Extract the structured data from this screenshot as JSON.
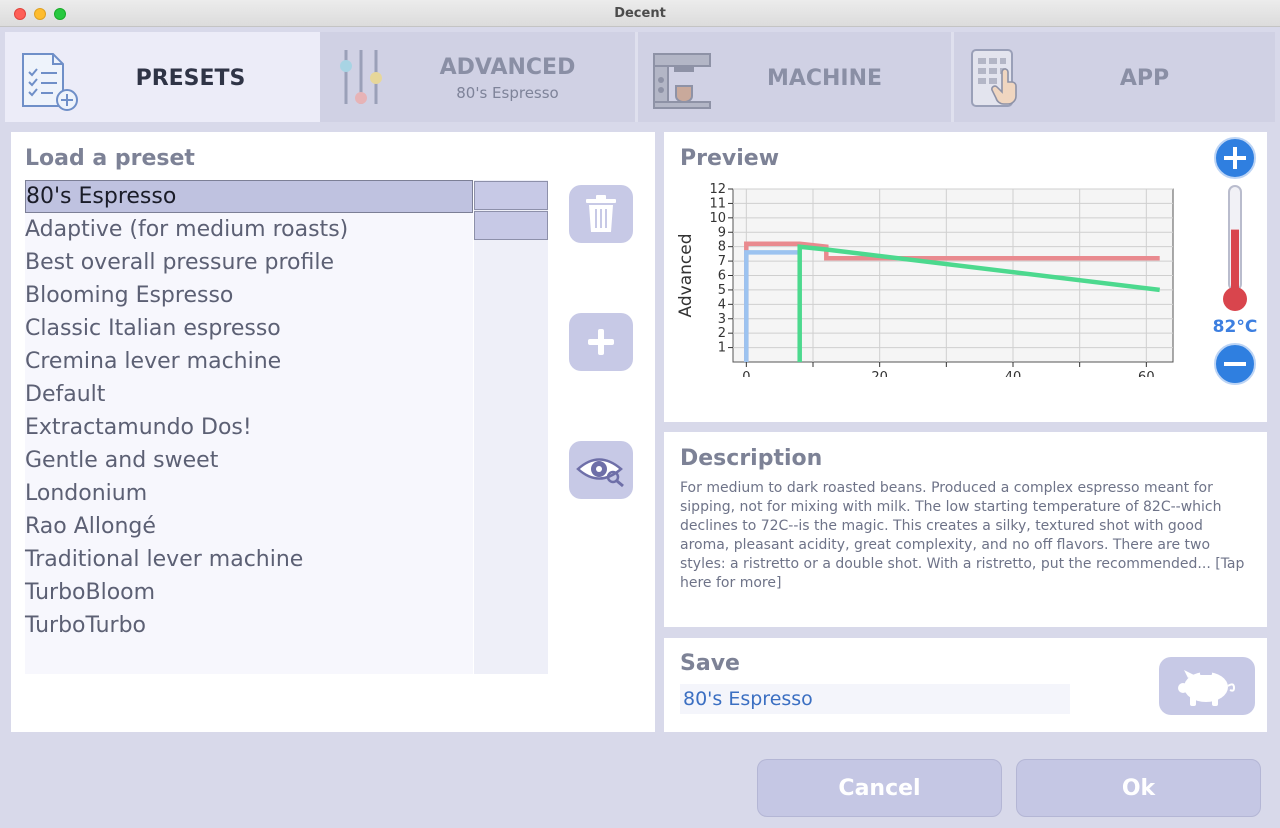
{
  "window": {
    "title": "Decent"
  },
  "tabs": [
    {
      "label": "PRESETS",
      "sub": "",
      "icon": "clipboard-list-icon"
    },
    {
      "label": "ADVANCED",
      "sub": "80's Espresso",
      "icon": "sliders-icon"
    },
    {
      "label": "MACHINE",
      "sub": "",
      "icon": "espresso-machine-icon"
    },
    {
      "label": "APP",
      "sub": "",
      "icon": "tablet-touch-icon"
    }
  ],
  "presets": {
    "title": "Load a preset",
    "items": [
      "80's Espresso",
      "Adaptive (for medium roasts)",
      "Best overall pressure profile",
      "Blooming Espresso",
      "Classic Italian espresso",
      "Cremina lever machine",
      "Default",
      "Extractamundo Dos!",
      "Gentle and sweet",
      "Londonium",
      "Rao Allongé",
      "Traditional lever machine",
      "TurboBloom",
      "TurboTurbo"
    ],
    "selected_index": 0
  },
  "preview": {
    "title": "Preview",
    "temperature": "82°C",
    "temperature_fraction": 0.6
  },
  "chart_data": {
    "type": "line",
    "ylabel": "Advanced",
    "xlabel": "",
    "xlim": [
      -2,
      64
    ],
    "ylim": [
      0,
      12
    ],
    "x_ticks": [
      0,
      20,
      40,
      60
    ],
    "y_ticks": [
      1,
      2,
      3,
      4,
      5,
      6,
      7,
      8,
      9,
      10,
      11,
      12
    ],
    "grid": true,
    "series": [
      {
        "color": "#e98a8f",
        "points": [
          [
            0,
            0
          ],
          [
            0,
            8.2
          ],
          [
            8,
            8.2
          ],
          [
            12,
            8.0
          ],
          [
            12,
            7.2
          ],
          [
            62,
            7.2
          ]
        ]
      },
      {
        "color": "#9cc3f0",
        "points": [
          [
            0,
            0
          ],
          [
            0,
            7.6
          ],
          [
            8,
            7.6
          ]
        ]
      },
      {
        "color": "#4cd98e",
        "points": [
          [
            8,
            0
          ],
          [
            8,
            8.0
          ],
          [
            12,
            7.8
          ],
          [
            62,
            5.0
          ]
        ]
      }
    ],
    "series_colors": [
      "#e98a8f",
      "#9cc3f0",
      "#4cd98e"
    ]
  },
  "description": {
    "title": "Description",
    "text": "For medium to dark roasted beans. Produced a complex espresso meant for sipping, not for mixing with milk. The low starting temperature of 82C--which declines to 72C--is the magic.  This creates a silky, textured shot with good aroma, pleasant acidity, great complexity, and no off flavors. There are two styles: a ristretto or a double shot.  With a ristretto, put the recommended... [Tap here for more]"
  },
  "save": {
    "title": "Save",
    "value": "80's Espresso"
  },
  "footer": {
    "cancel_label": "Cancel",
    "ok_label": "Ok"
  },
  "colors": {
    "accent": "#2f7fe0",
    "button_fill": "#c7c9e6",
    "panel_bg": "#ffffff",
    "window_bg": "#d8d9ea"
  }
}
